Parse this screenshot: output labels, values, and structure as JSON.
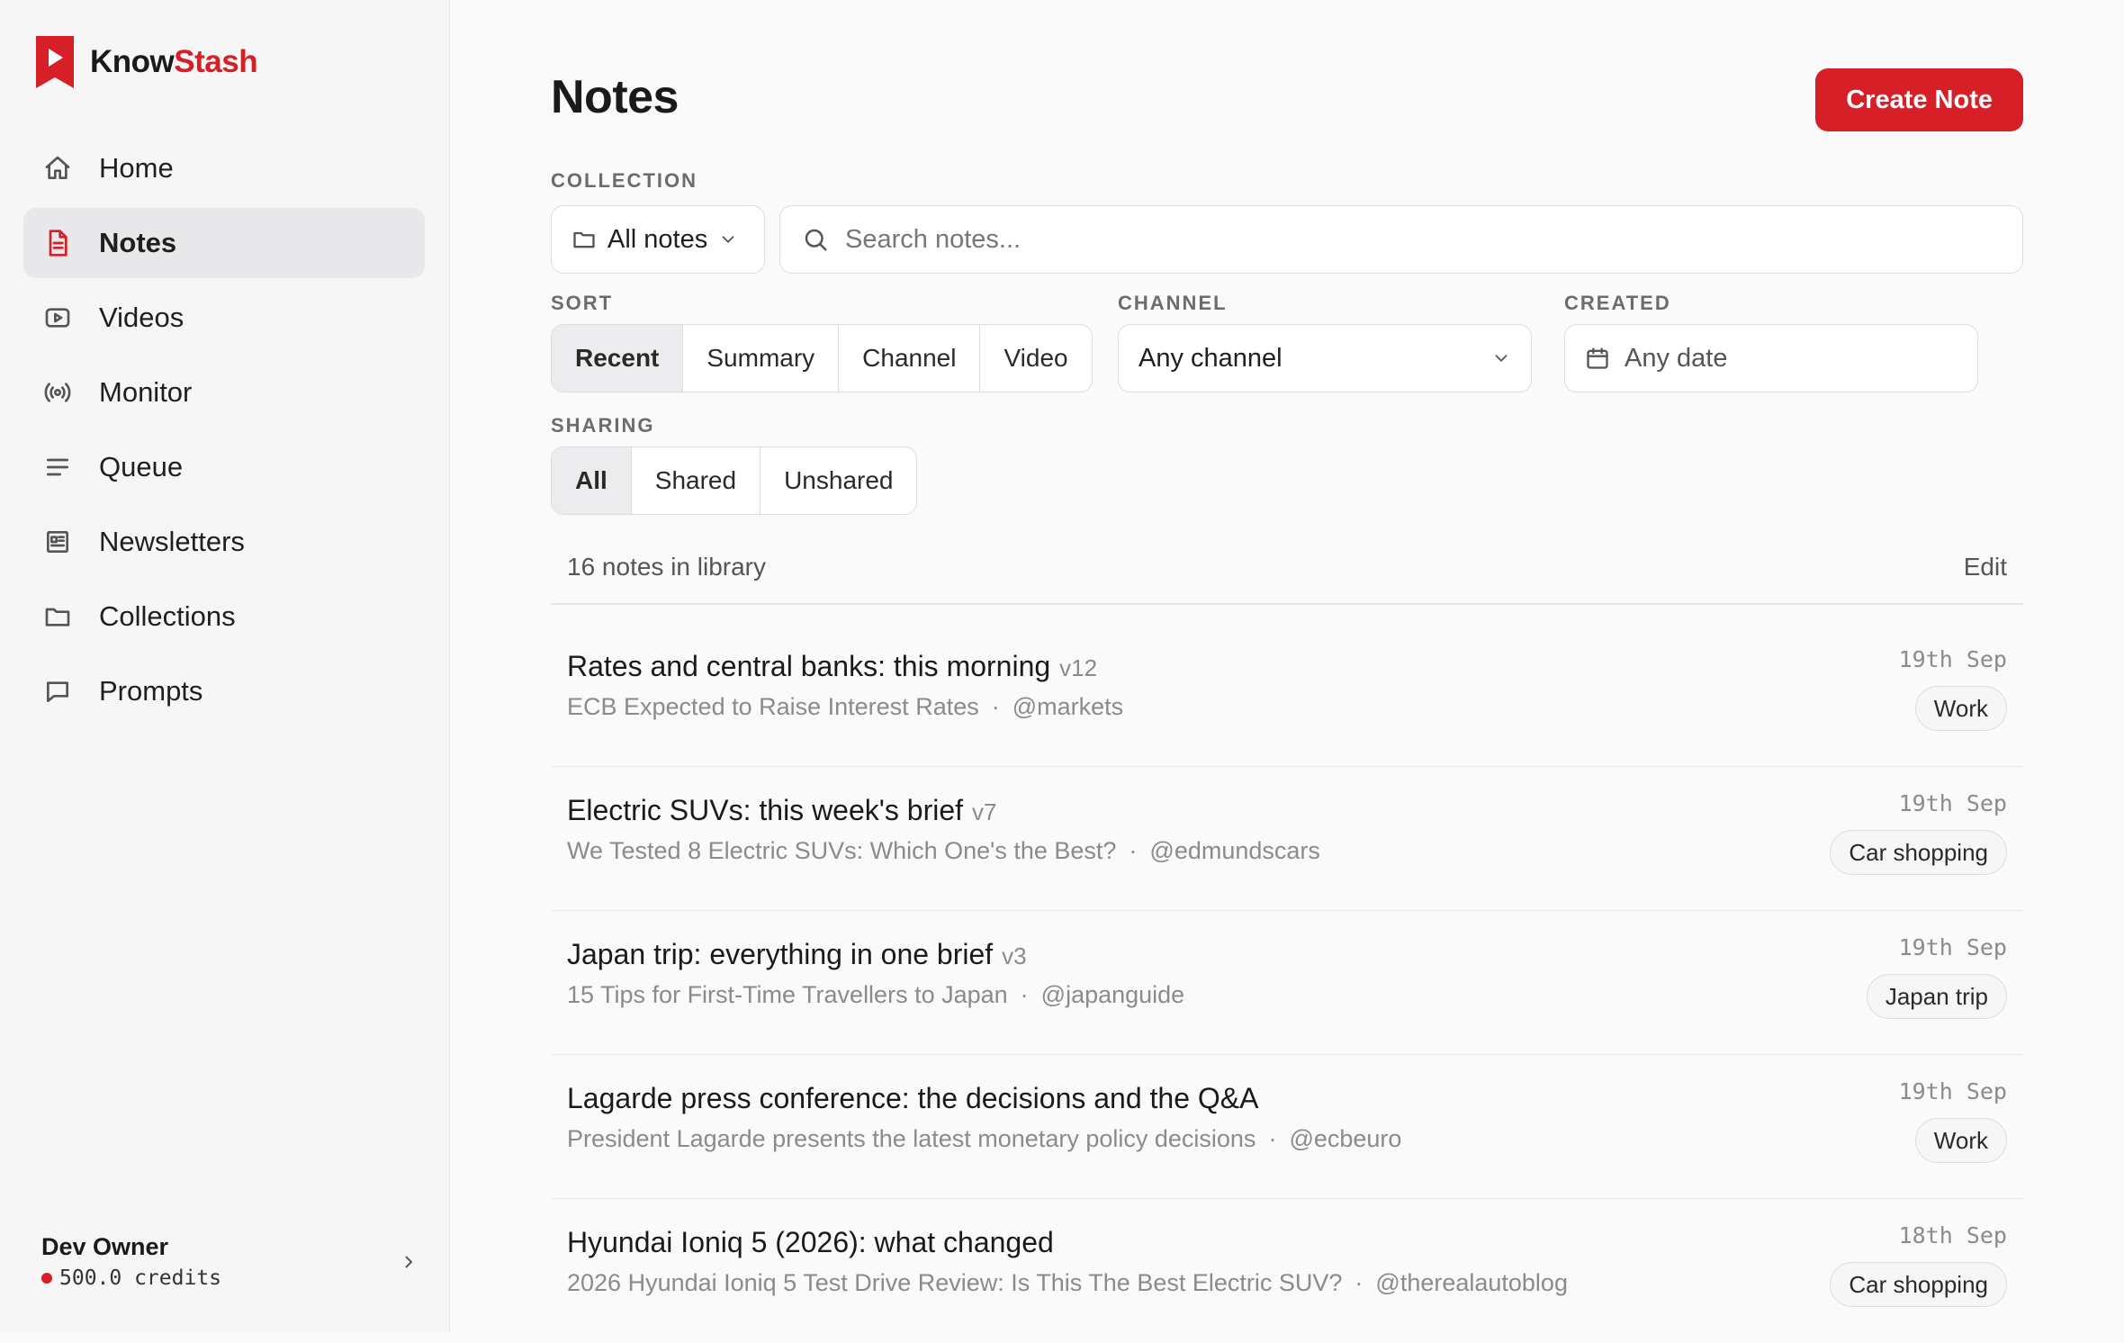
{
  "app": {
    "brand_a": "Know",
    "brand_b": "Stash",
    "accent": "#d61f26"
  },
  "sidebar": {
    "items": [
      {
        "label": "Home",
        "icon": "home-icon"
      },
      {
        "label": "Notes",
        "icon": "document-icon",
        "active": true
      },
      {
        "label": "Videos",
        "icon": "video-icon"
      },
      {
        "label": "Monitor",
        "icon": "broadcast-icon"
      },
      {
        "label": "Queue",
        "icon": "list-icon"
      },
      {
        "label": "Newsletters",
        "icon": "newspaper-icon"
      },
      {
        "label": "Collections",
        "icon": "folder-icon"
      },
      {
        "label": "Prompts",
        "icon": "chat-icon"
      }
    ]
  },
  "user": {
    "name": "Dev Owner",
    "credits": "500.0 credits"
  },
  "page": {
    "title": "Notes",
    "create_label": "Create Note"
  },
  "filters": {
    "collection_label": "COLLECTION",
    "collection_value": "All notes",
    "search_placeholder": "Search notes...",
    "sort_label": "SORT",
    "sort_options": [
      "Recent",
      "Summary",
      "Channel",
      "Video"
    ],
    "channel_label": "CHANNEL",
    "channel_value": "Any channel",
    "created_label": "CREATED",
    "created_value": "Any date",
    "sharing_label": "SHARING",
    "sharing_options": [
      "All",
      "Shared",
      "Unshared"
    ]
  },
  "list": {
    "count": "16 notes in library",
    "edit": "Edit",
    "notes": [
      {
        "title": "Rates and central banks: this morning",
        "version": "v12",
        "source": "ECB Expected to Raise Interest Rates",
        "channel": "@markets",
        "date": "19th Sep",
        "tag": "Work"
      },
      {
        "title": "Electric SUVs: this week's brief",
        "version": "v7",
        "source": "We Tested 8 Electric SUVs: Which One's the Best?",
        "channel": "@edmundscars",
        "date": "19th Sep",
        "tag": "Car shopping"
      },
      {
        "title": "Japan trip: everything in one brief",
        "version": "v3",
        "source": "15 Tips for First-Time Travellers to Japan",
        "channel": "@japanguide",
        "date": "19th Sep",
        "tag": "Japan trip"
      },
      {
        "title": "Lagarde press conference: the decisions and the Q&A",
        "version": "",
        "source": "President Lagarde presents the latest monetary policy decisions",
        "channel": "@ecbeuro",
        "date": "19th Sep",
        "tag": "Work"
      },
      {
        "title": "Hyundai Ioniq 5 (2026): what changed",
        "version": "",
        "source": "2026 Hyundai Ioniq 5 Test Drive Review: Is This The Best Electric SUV?",
        "channel": "@therealautoblog",
        "date": "18th Sep",
        "tag": "Car shopping"
      }
    ]
  }
}
